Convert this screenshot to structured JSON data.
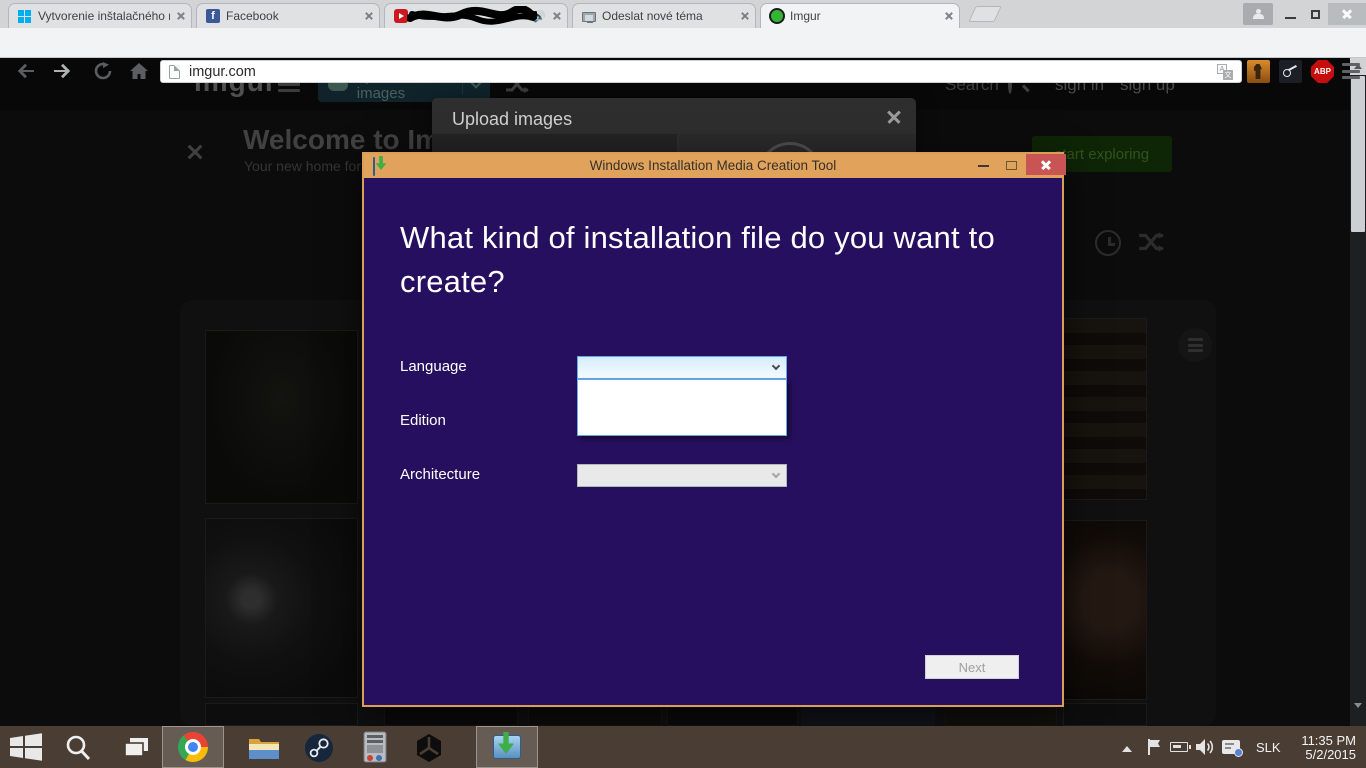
{
  "browser": {
    "tabs": [
      {
        "title": "Vytvorenie inštalačného m",
        "icon": "windows-logo"
      },
      {
        "title": "Facebook",
        "icon": "facebook"
      },
      {
        "title": "",
        "icon": "youtube",
        "note": "title scribbled out, audio playing"
      },
      {
        "title": "Odeslat nové téma",
        "icon": "monitor"
      },
      {
        "title": "Imgur",
        "icon": "imgur-green-circle",
        "active": true
      }
    ],
    "facebook_f": "f",
    "address": "imgur.com",
    "extensions": {
      "abp_label": "ABP"
    }
  },
  "imgur": {
    "logo": "imgur",
    "upload_button_label": "upload images",
    "search_label": "Search",
    "sign_in_label": "sign in",
    "sign_up_label": "sign up",
    "welcome_title": "Welcome to Imgur",
    "welcome_subtitle": "Your new home for",
    "start_exploring_label": "start exploring"
  },
  "upload_dialog": {
    "title": "Upload images"
  },
  "media_tool": {
    "window_title": "Windows Installation Media Creation Tool",
    "heading": "What kind of installation file do you want to create?",
    "language_label": "Language",
    "language_value": "",
    "edition_label": "Edition",
    "architecture_label": "Architecture",
    "next_label": "Next",
    "colors": {
      "titlebar": "#e1a35c",
      "body": "#270f5f",
      "close_button": "#c85454"
    }
  },
  "taskbar": {
    "language_indicator": "SLK",
    "time": "11:35 PM",
    "date": "5/2/2015"
  }
}
